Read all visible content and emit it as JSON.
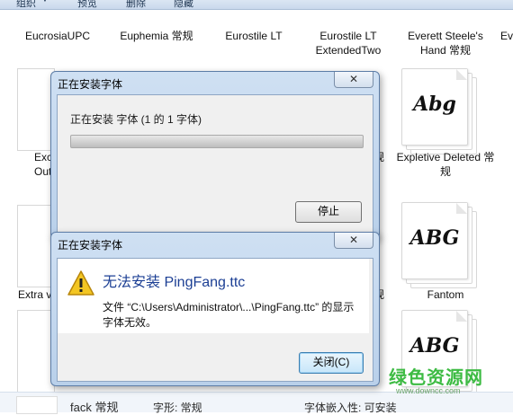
{
  "toolbar": {
    "organize": "组织",
    "preview": "预览",
    "delete": "删除",
    "hide": "隐藏"
  },
  "gallery": {
    "row1": [
      {
        "name": "EucrosiaUPC"
      },
      {
        "name": "Euphemia 常规"
      },
      {
        "name": "Eurostile LT"
      },
      {
        "name": "Eurostile LT ExtendedTwo"
      },
      {
        "name": "Everett Steele's Hand 常规"
      },
      {
        "name": "Eve"
      }
    ],
    "row2": [
      {
        "name": "Exc Outlin"
      },
      {
        "name": "规"
      },
      {
        "name": "Expletive Deleted 常规"
      }
    ],
    "row3": [
      {
        "name": "Extra v"
      },
      {
        "name": "规"
      },
      {
        "name": "Fantom"
      }
    ],
    "glyphs": {
      "expletive": "Abg",
      "fantom": "ABG",
      "row4": "ABG"
    }
  },
  "status_bar": {
    "name": "fack 常规",
    "type_label": "字形: 常规",
    "embed_label": "字体嵌入性: 可安装"
  },
  "progress_dialog": {
    "title": "正在安装字体",
    "message": "正在安装 字体 (1 的 1 字体)",
    "close_glyph": "✕",
    "stop_label": "停止",
    "progress": 0.0
  },
  "error_dialog": {
    "title": "正在安装字体",
    "close_glyph": "✕",
    "main_message": "无法安装 PingFang.ttc",
    "detail": "文件 “C:\\Users\\Administrator\\...\\PingFang.ttc” 的显示字体无效。",
    "close_label": "关闭(C)"
  },
  "watermark": {
    "cn": "绿色资源网",
    "url": "www.downcc.com"
  }
}
